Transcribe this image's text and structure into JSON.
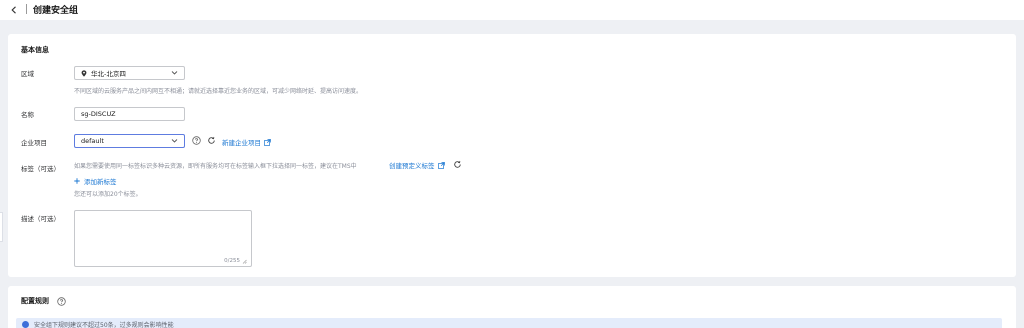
{
  "header": {
    "title": "创建安全组"
  },
  "basic": {
    "section_title": "基本信息",
    "region": {
      "label": "区域",
      "value": "华北-北京四",
      "hint": "不同区域的云服务产品之间内网互不相通；请就近选择靠近您业务的区域，可减少网络时延、提高访问速度。"
    },
    "name": {
      "label": "名称",
      "value": "sg-DISCUZ"
    },
    "enterprise_project": {
      "label": "企业项目",
      "value": "default",
      "create_link": "新建企业项目"
    },
    "tags": {
      "label": "标签（可选）",
      "hint_prefix": "如果您需要使用同一标签标识多种云资源，即所有服务均可在标签输入框下拉选择同一标签，建议在TMS中",
      "create_link": "创建预定义标签",
      "add_label": "添加新标签",
      "remaining": "您还可以添加20个标签。"
    },
    "description": {
      "label": "描述（可选）",
      "counter": "0/255"
    }
  },
  "rules": {
    "section_title": "配置规则",
    "info_text": "安全组下规则建议不超过50条，过多规则会影响性能"
  },
  "colors": {
    "link": "#1976d2",
    "info_bg": "#e4ecfb",
    "page_bg": "#eef0f4"
  }
}
